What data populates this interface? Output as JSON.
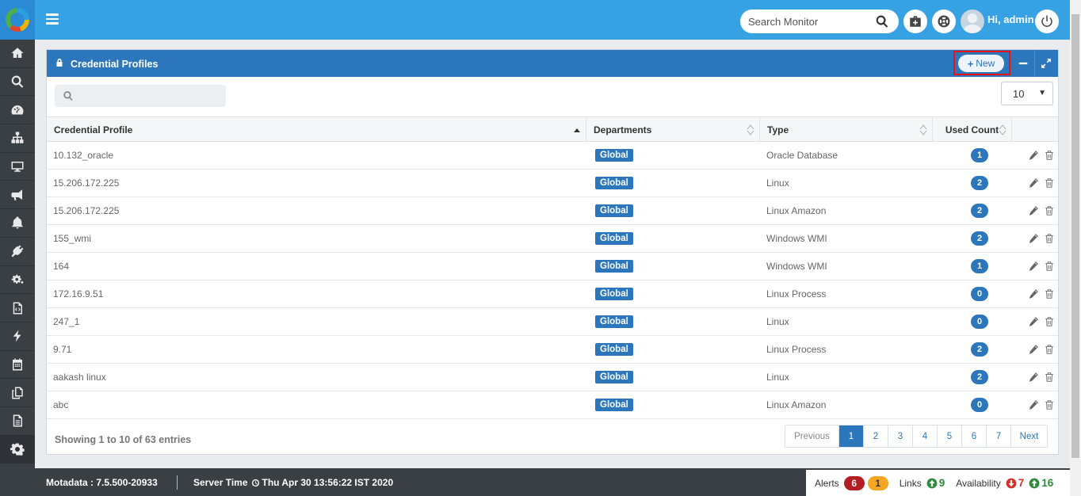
{
  "header": {
    "search_placeholder": "Search Monitor",
    "greeting": "Hi, admin"
  },
  "sidebar": {
    "items": [
      {
        "icon": "home-icon"
      },
      {
        "icon": "search-icon"
      },
      {
        "icon": "dashboard-icon"
      },
      {
        "icon": "topology-icon"
      },
      {
        "icon": "monitor-icon"
      },
      {
        "icon": "megaphone-icon"
      },
      {
        "icon": "bell-icon"
      },
      {
        "icon": "plug-icon"
      },
      {
        "icon": "gears-icon"
      },
      {
        "icon": "code-file-icon"
      },
      {
        "icon": "bolt-icon"
      },
      {
        "icon": "calendar-icon"
      },
      {
        "icon": "copy-icon"
      },
      {
        "icon": "document-icon"
      },
      {
        "icon": "settings-icon"
      }
    ]
  },
  "panel": {
    "title": "Credential Profiles",
    "new_label": "New",
    "page_size": "10"
  },
  "table": {
    "columns": [
      "Credential Profile",
      "Departments",
      "Type",
      "Used Count"
    ],
    "rows": [
      {
        "name": "10.132_oracle",
        "department": "Global",
        "type": "Oracle Database",
        "count": "1"
      },
      {
        "name": "15.206.172.225",
        "department": "Global",
        "type": "Linux",
        "count": "2"
      },
      {
        "name": "15.206.172.225",
        "department": "Global",
        "type": "Linux Amazon",
        "count": "2"
      },
      {
        "name": "155_wmi",
        "department": "Global",
        "type": "Windows WMI",
        "count": "2"
      },
      {
        "name": "164",
        "department": "Global",
        "type": "Windows WMI",
        "count": "1"
      },
      {
        "name": "172.16.9.51",
        "department": "Global",
        "type": "Linux Process",
        "count": "0"
      },
      {
        "name": "247_1",
        "department": "Global",
        "type": "Linux",
        "count": "0"
      },
      {
        "name": "9.71",
        "department": "Global",
        "type": "Linux Process",
        "count": "2"
      },
      {
        "name": "aakash linux",
        "department": "Global",
        "type": "Linux",
        "count": "2"
      },
      {
        "name": "abc",
        "department": "Global",
        "type": "Linux Amazon",
        "count": "0"
      }
    ]
  },
  "footer_table": {
    "summary": "Showing 1 to 10 of 63 entries",
    "pagination": {
      "prev": "Previous",
      "pages": [
        "1",
        "2",
        "3",
        "4",
        "5",
        "6",
        "7"
      ],
      "next": "Next",
      "active": "1"
    }
  },
  "footer": {
    "version": "Motadata : 7.5.500-20933",
    "server_time_label": "Server Time",
    "server_time": "Thu Apr 30 13:56:22 IST 2020",
    "alerts_label": "Alerts",
    "alerts_critical": "6",
    "alerts_warning": "1",
    "links_label": "Links",
    "links_up": "9",
    "availability_label": "Availability",
    "availability_down": "7",
    "availability_up": "16"
  },
  "colors": {
    "topbar": "#37a2e3",
    "panel_header": "#2c77bb",
    "sidebar": "#3a3f44",
    "highlight_border": "#ee1111"
  }
}
